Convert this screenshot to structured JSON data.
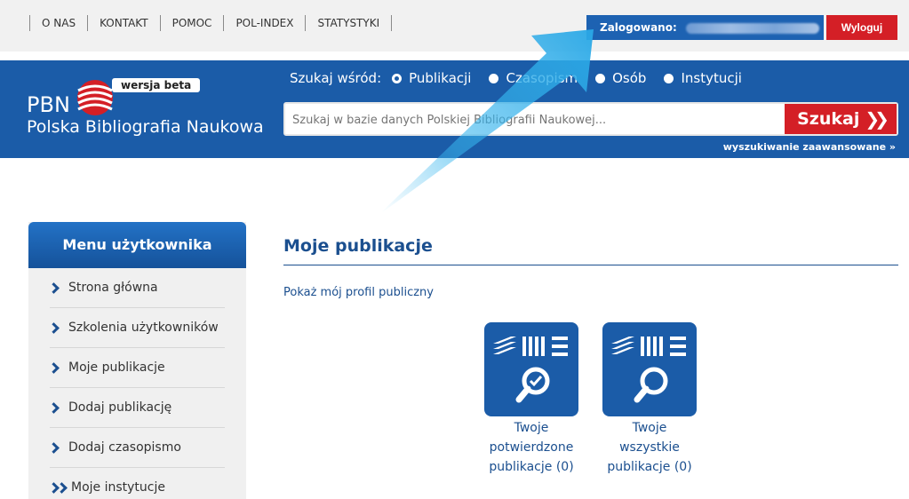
{
  "topnav": {
    "items": [
      "O NAS",
      "KONTAKT",
      "POMOC",
      "POL-INDEX",
      "STATYSTYKI"
    ]
  },
  "account": {
    "logged_label": "Zalogowano:",
    "logout_label": "Wyloguj"
  },
  "logo": {
    "short": "PBN",
    "full": "Polska Bibliografia Naukowa",
    "beta": "wersja beta"
  },
  "search": {
    "among_label": "Szukaj wśród:",
    "options": [
      "Publikacji",
      "Czasopism",
      "Osób",
      "Instytucji"
    ],
    "selected": "Publikacji",
    "placeholder": "Szukaj w bazie danych Polskiej Bibliografii Naukowej...",
    "button_label": "Szukaj",
    "advanced_label": "wyszukiwanie zaawansowane »"
  },
  "sidebar": {
    "title": "Menu użytkownika",
    "items": [
      {
        "label": "Strona główna"
      },
      {
        "label": "Szkolenia użytkowników"
      },
      {
        "label": "Moje publikacje"
      },
      {
        "label": "Dodaj publikację"
      },
      {
        "label": "Dodaj czasopismo"
      },
      {
        "label": "Moje instytucje"
      }
    ]
  },
  "main": {
    "title": "Moje publikacje",
    "profile_link": "Pokaż mój profil publiczny",
    "tiles": [
      {
        "line1": "Twoje",
        "line2": "potwierdzone",
        "line3": "publikacje (0)"
      },
      {
        "line1": "Twoje",
        "line2": "wszystkie",
        "line3": "publikacje (0)"
      }
    ]
  },
  "colors": {
    "brand_blue": "#1b5ca8",
    "accent_red": "#d41f26",
    "highlight_arrow": "#38b6ee"
  }
}
